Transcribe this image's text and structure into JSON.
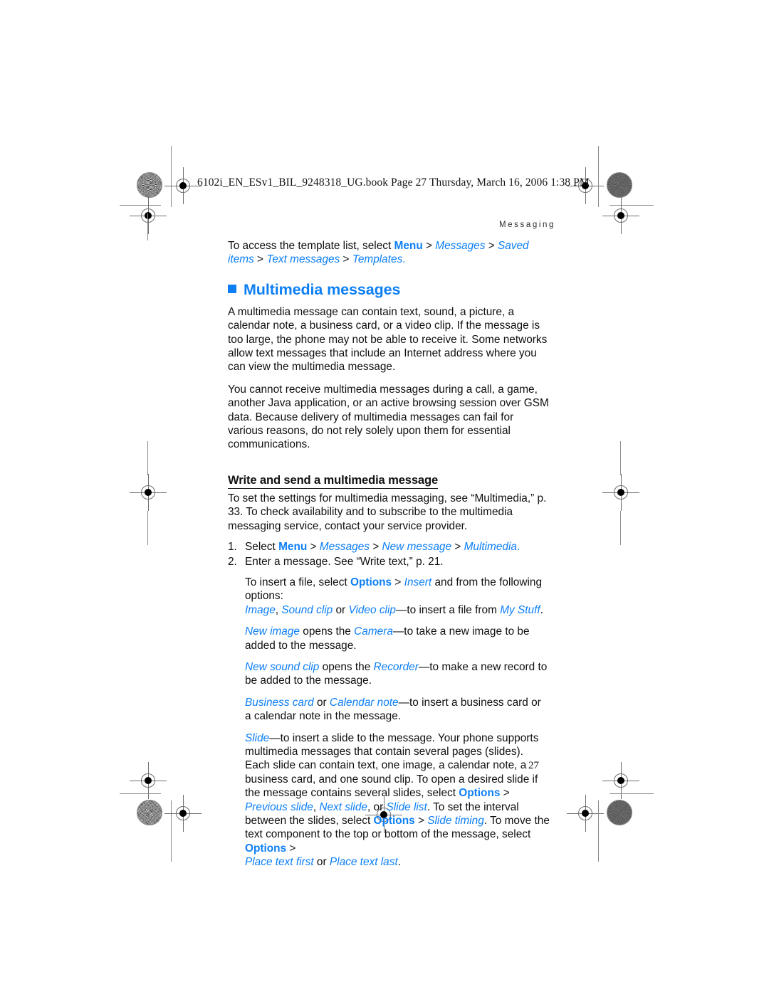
{
  "document": {
    "book_line": "6102i_EN_ESv1_BIL_9248318_UG.book  Page 27  Thursday, March 16, 2006  1:38 PM",
    "running_header": "Messaging",
    "page_number": "27",
    "accent_color": "#0d7ff5",
    "text_color": "#0f0f0f"
  },
  "intro": {
    "line1_a": "To access the template list, select ",
    "menu": "Menu",
    "sep": " > ",
    "messages": "Messages",
    "saved_items": "Saved items",
    "text_messages": "Text messages",
    "templates": "Templates",
    "period": "."
  },
  "heading": {
    "bullet_icon": "filled-square-bullet",
    "title": "Multimedia messages"
  },
  "paragraphs": {
    "p1": "A multimedia message can contain text, sound, a picture, a calendar note, a business card, or a video clip. If the message is too large, the phone may not be able to receive it. Some networks allow text messages that include an Internet address where you can view the multimedia message.",
    "p2": "You cannot receive multimedia messages during a call, a game, another Java application, or an active browsing session over GSM data. Because delivery of multimedia messages can fail for various reasons, do not rely solely upon them for essential communications."
  },
  "subheading": {
    "title": "Write and send a multimedia message"
  },
  "intro2": {
    "text": "To set the settings for multimedia messaging, see “Multimedia,” p. 33. To check availability and to subscribe to the multimedia messaging service, contact your service provider."
  },
  "steps": [
    {
      "num": "1.",
      "lead": "Select ",
      "menu": "Menu",
      "messages": "Messages",
      "new_message": "New message",
      "multimedia": "Multimedia",
      "tail": "."
    },
    {
      "num": "2.",
      "text": "Enter a message. See “Write text,” p. 21."
    }
  ],
  "options_block": {
    "insert_lead": "To insert a file, select ",
    "options": "Options",
    "insert": "Insert",
    "insert_tail": " and from the following options:",
    "image": "Image",
    "comma": ", ",
    "sound_clip": "Sound clip",
    "or": " or ",
    "video_clip": "Video clip",
    "file_from": "—to insert a file from ",
    "my_stuff": "My Stuff",
    "period": ".",
    "new_image": "New image",
    "opens_the": " opens the ",
    "camera": "Camera",
    "new_image_tail": "—to take a new image to be added to the message.",
    "new_sound_clip": "New sound clip",
    "recorder": "Recorder",
    "new_sound_tail": "—to make a new record to be added to the message.",
    "business_card": "Business card",
    "or2": " or ",
    "calendar_note": "Calendar note",
    "business_tail": "—to insert a business card or a calendar note in the message.",
    "slide": "Slide",
    "slide_text_1": "—to insert a slide to the message. Your phone supports multimedia messages that contain several pages (slides). Each slide can contain text, one image, a calendar note, a business card, and one sound clip. To open a desired slide if the message contains several slides, select ",
    "previous_slide": "Previous slide",
    "next_slide": "Next slide",
    "or3": ", or ",
    "slide_list": "Slide list",
    "slide_text_2": ". To set the interval between the slides, select ",
    "slide_timing": "Slide timing",
    "slide_text_3": ". To move the text component to the top or bottom of the message, select ",
    "place_text_first": "Place text first",
    "or4": " or ",
    "place_text_last": "Place text last",
    "final_period": "."
  }
}
